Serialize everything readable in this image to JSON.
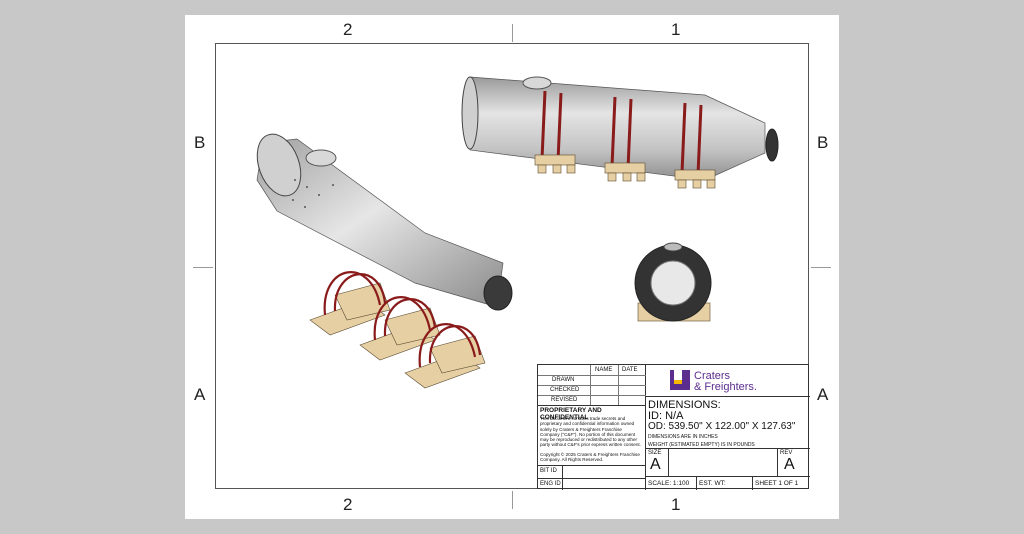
{
  "zones": {
    "col_left": "2",
    "col_right": "1",
    "row_top": "B",
    "row_bottom": "A"
  },
  "title_block": {
    "name_header": "NAME",
    "date_header": "DATE",
    "rows": [
      "DRAWN",
      "CHECKED",
      "REVISED"
    ],
    "proprietary_title": "PROPRIETARY AND CONFIDENTIAL",
    "proprietary_text": "This document contains trade secrets and proprietary and confidential information owned solely by Craters & Freighters Franchise Company (\"C&F\"). No portion of this document may be reproduced or redistributed to any other party without C&F's prior express written consent.",
    "copyright": "Copyright © 2025 Craters & Freighters Franchise Company. All Rights Reserved.",
    "bit_id": "BIT ID",
    "eng_id": "ENG ID",
    "logo_line1": "Craters",
    "logo_line2": "& Freighters.",
    "dimensions_label": "DIMENSIONS:",
    "id_line": "ID: N/A",
    "od_line": "OD: 539.50\" X 122.00\" X 127.63\"",
    "dims_in_inches": "DIMENSIONS ARE IN INCHES",
    "weight_note": "WEIGHT (ESTIMATED EMPTY) IS IN POUNDS",
    "size_label": "SIZE",
    "size_value": "A",
    "rev_label": "REV",
    "rev_value": "A",
    "scale": "SCALE: 1:100",
    "est_wt": "EST. WT:",
    "sheet": "SHEET 1 OF 1"
  },
  "colors": {
    "brand_purple": "#5b2d8e",
    "brand_yellow": "#f5b800",
    "strap_red": "#8a1b1b",
    "wood": "#e6cfa3",
    "steel": "#b9b9b9"
  }
}
